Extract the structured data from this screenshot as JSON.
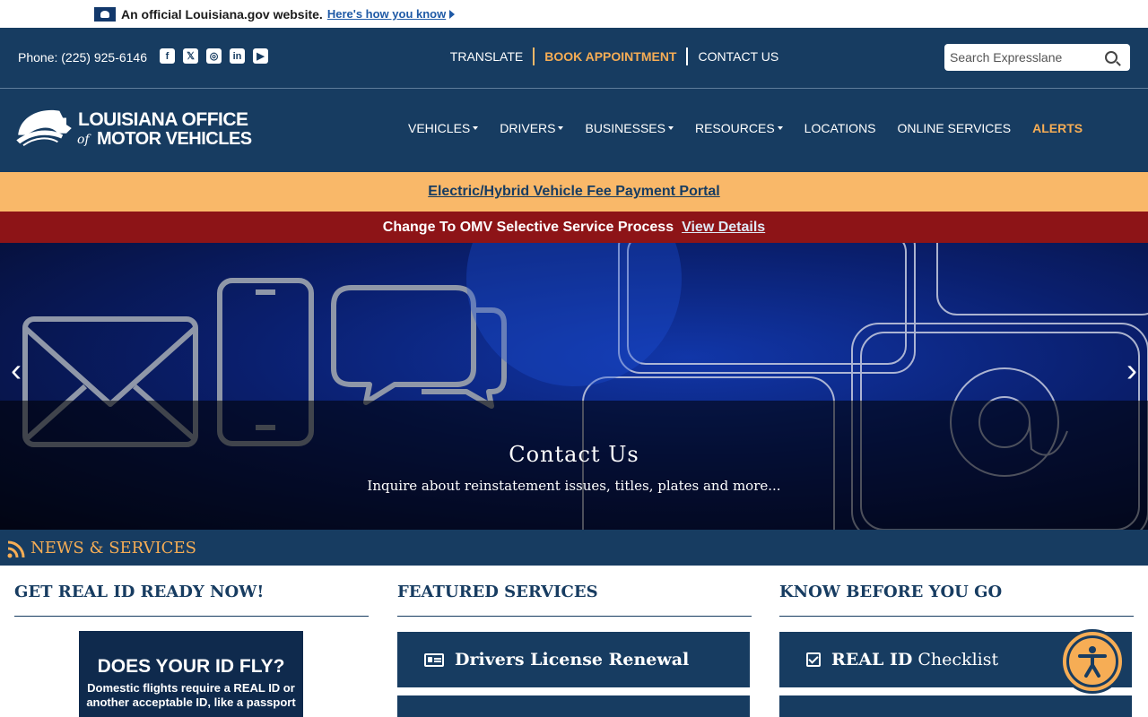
{
  "gov_banner": {
    "text": "An official Louisiana.gov website.",
    "link": "Here's how you know"
  },
  "utility": {
    "phone": "Phone: (225) 925-6146",
    "socials": [
      "facebook-icon",
      "x-icon",
      "instagram-icon",
      "linkedin-icon",
      "youtube-icon"
    ],
    "links": {
      "translate": "TRANSLATE",
      "book": "BOOK APPOINTMENT",
      "contact": "CONTACT US"
    },
    "search_placeholder": "Search Expresslane"
  },
  "logo": {
    "line1": "LOUISIANA OFFICE",
    "of": "of",
    "line2": "MOTOR VEHICLES"
  },
  "nav": {
    "vehicles": "VEHICLES",
    "drivers": "DRIVERS",
    "businesses": "BUSINESSES",
    "resources": "RESOURCES",
    "locations": "LOCATIONS",
    "online_services": "ONLINE SERVICES",
    "alerts": "ALERTS"
  },
  "banners": {
    "ev_link": "Electric/Hybrid Vehicle Fee Payment Portal",
    "alert_text": "Change To OMV Selective Service Process",
    "alert_link": "View Details"
  },
  "hero": {
    "title": "Contact Us",
    "subtitle": "Inquire about reinstatement issues, titles, plates and more..."
  },
  "news": {
    "title": "NEWS & SERVICES"
  },
  "columns": {
    "real_id": {
      "title": "GET REAL ID READY NOW!",
      "img_heading": "DOES YOUR ID FLY?",
      "img_text": "Domestic flights require a REAL ID or another acceptable ID, like a passport"
    },
    "featured": {
      "title": "FEATURED SERVICES",
      "btn1": "Drivers License Renewal"
    },
    "know": {
      "title": "KNOW BEFORE YOU GO",
      "btn1_bold": "REAL ID",
      "btn1_light": " Checklist"
    }
  },
  "colors": {
    "navy": "#173c61",
    "accent": "#f6ad55",
    "ev_banner": "#f9b869",
    "alert_red": "#8d1417"
  }
}
